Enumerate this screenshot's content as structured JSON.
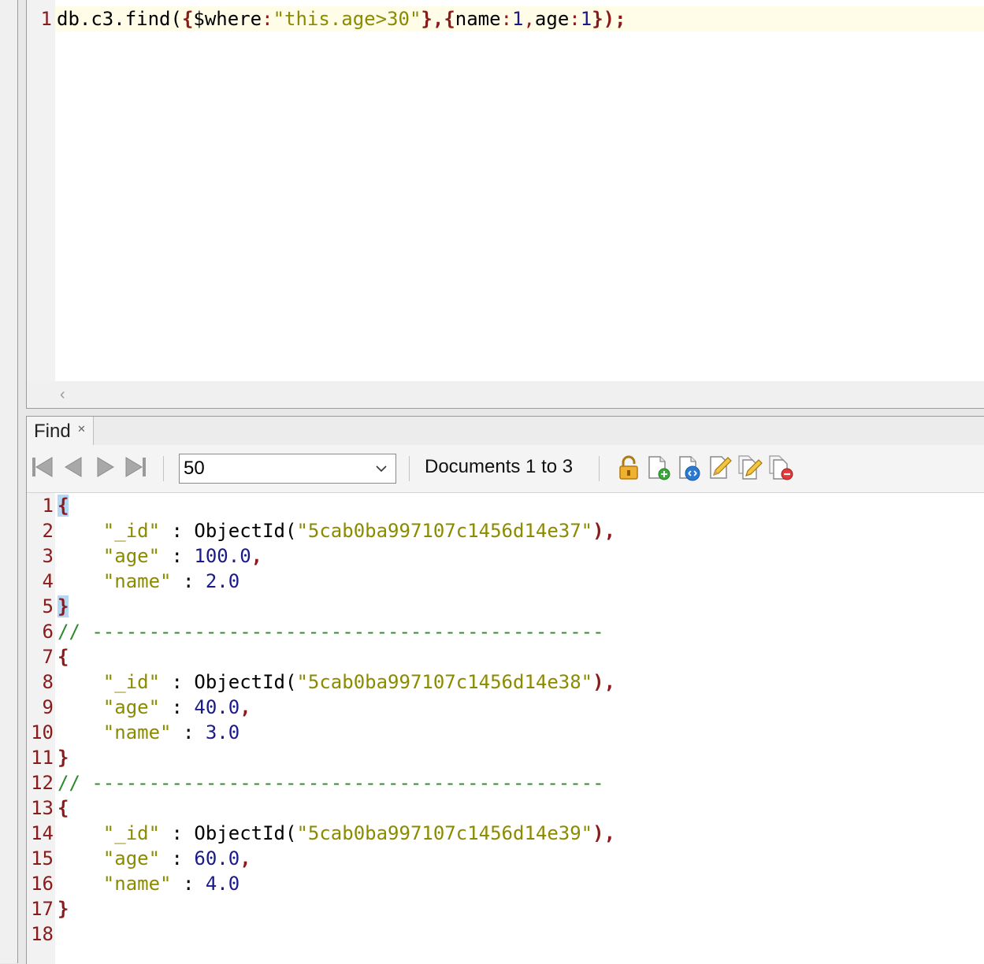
{
  "editor": {
    "line_number": "1",
    "query": {
      "p1": "db.c3.find(",
      "p2": "{",
      "p3": "$where",
      "p4": ":",
      "p5": "\"this.age>30\"",
      "p6": "},",
      "p7": "{",
      "p8": "name",
      "p9": ":",
      "p10": "1",
      "p11": ",",
      "p12": "age",
      "p13": ":",
      "p14": "1",
      "p15": "});"
    }
  },
  "find_tab": {
    "label": "Find",
    "close": "✕"
  },
  "toolbar": {
    "page_size": "50",
    "documents_label": "Documents 1 to 3"
  },
  "results": {
    "line_numbers": [
      "1",
      "2",
      "3",
      "4",
      "5",
      "6",
      "7",
      "8",
      "9",
      "10",
      "11",
      "12",
      "13",
      "14",
      "15",
      "16",
      "17",
      "18"
    ],
    "separator": "// ---------------------------------------------",
    "documents": [
      {
        "id_key": "\"_id\"",
        "oid_fn": "ObjectId(",
        "oid": "\"5cab0ba997107c1456d14e37\"",
        "age_key": "\"age\"",
        "age": "100.0",
        "name_key": "\"name\"",
        "name": "2.0"
      },
      {
        "id_key": "\"_id\"",
        "oid_fn": "ObjectId(",
        "oid": "\"5cab0ba997107c1456d14e38\"",
        "age_key": "\"age\"",
        "age": "40.0",
        "name_key": "\"name\"",
        "name": "3.0"
      },
      {
        "id_key": "\"_id\"",
        "oid_fn": "ObjectId(",
        "oid": "\"5cab0ba997107c1456d14e39\"",
        "age_key": "\"age\"",
        "age": "60.0",
        "name_key": "\"name\"",
        "name": "4.0"
      }
    ],
    "open_brace": "{",
    "close_brace": "}",
    "colon": " : ",
    "comma": ",",
    "close_paren_comma": "),"
  },
  "icons": [
    "first-page-icon",
    "prev-page-icon",
    "next-page-icon",
    "last-page-icon",
    "chevron-down-icon",
    "lock-icon",
    "add-document-icon",
    "view-document-icon",
    "edit-document-icon",
    "edit-multiple-icon",
    "delete-document-icon"
  ]
}
